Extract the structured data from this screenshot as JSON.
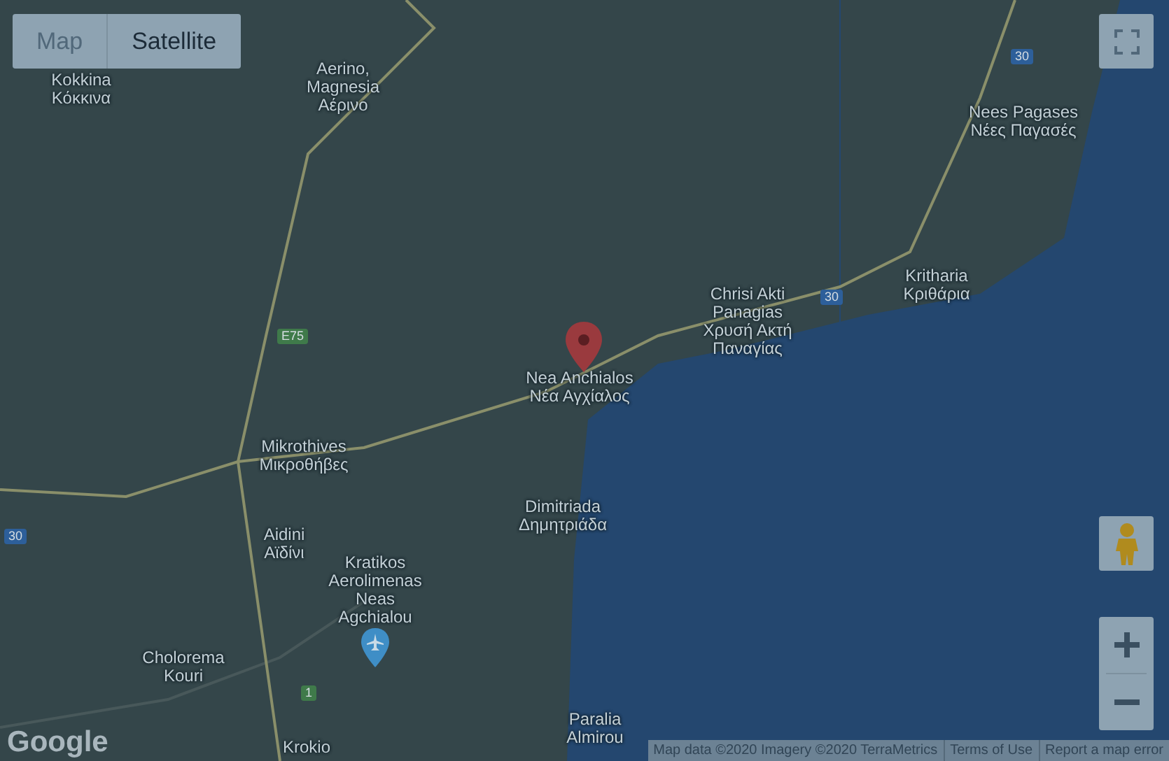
{
  "map_type_tabs": [
    {
      "label": "Map",
      "selected": false
    },
    {
      "label": "Satellite",
      "selected": true
    }
  ],
  "place_labels": [
    {
      "lines": [
        "Kokkina",
        "Κόκκινα"
      ]
    },
    {
      "lines": [
        "Aerino,",
        "Magnesia",
        "Αέρινο"
      ]
    },
    {
      "lines": [
        "Nees Pagases",
        "Νέες Παγασές"
      ]
    },
    {
      "lines": [
        "Kritharia",
        "Κριθάρια"
      ]
    },
    {
      "lines": [
        "Chrisi Akti",
        "Panagias",
        "Χρυσή Ακτή",
        "Παναγίας"
      ]
    },
    {
      "lines": [
        "Nea Anchialos",
        "Νέα Αγχίαλος"
      ]
    },
    {
      "lines": [
        "Mikrothives",
        "Μικροθήβες"
      ]
    },
    {
      "lines": [
        "Dimitriada",
        "Δημητριάδα"
      ]
    },
    {
      "lines": [
        "Aidini",
        "Αϊδίνι"
      ]
    },
    {
      "lines": [
        "Kratikos",
        "Aerolimenas",
        "Neas",
        "Agchialou"
      ]
    },
    {
      "lines": [
        "Cholorema",
        "Kouri"
      ]
    },
    {
      "lines": [
        "Krokio"
      ]
    },
    {
      "lines": [
        "Paralia",
        "Almirou"
      ]
    }
  ],
  "road_shields": [
    {
      "label": "30",
      "color": "#2d5f9a"
    },
    {
      "label": "30",
      "color": "#2d5f9a"
    },
    {
      "label": "E75",
      "color": "#3f7a4a"
    },
    {
      "label": "30",
      "color": "#2d5f9a"
    },
    {
      "label": "1",
      "color": "#3f7a4a"
    }
  ],
  "logo": "Google",
  "attribution": [
    "Map data ©2020 Imagery ©2020 TerraMetrics",
    "Terms of Use",
    "Report a map error"
  ]
}
